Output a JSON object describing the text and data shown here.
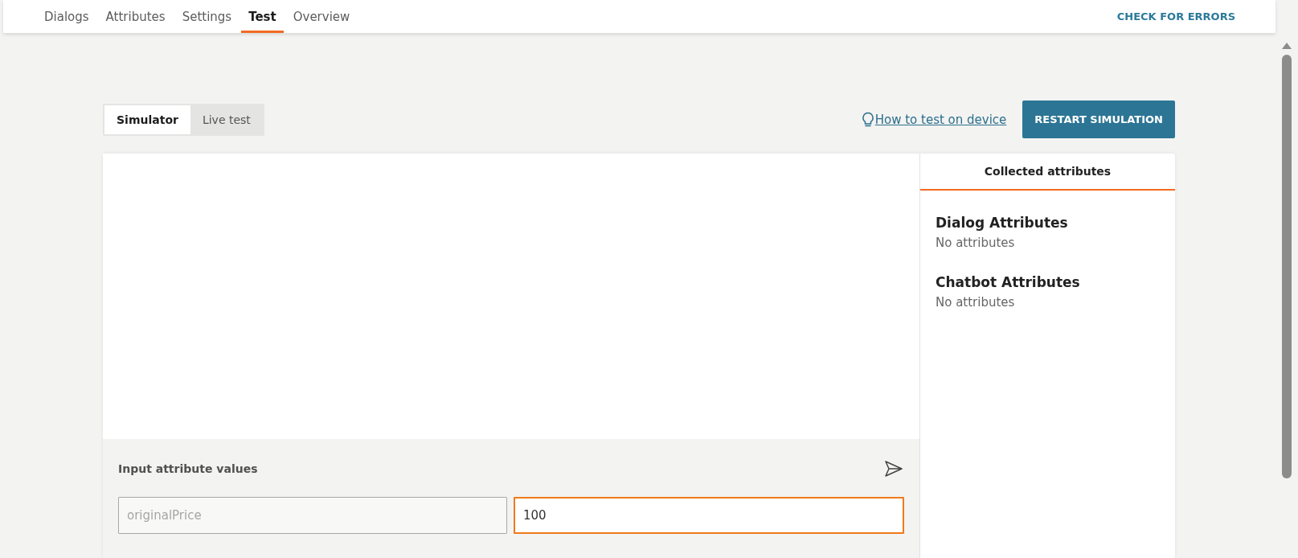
{
  "nav": {
    "tabs": [
      {
        "label": "Dialogs",
        "selected": false
      },
      {
        "label": "Attributes",
        "selected": false
      },
      {
        "label": "Settings",
        "selected": false
      },
      {
        "label": "Test",
        "selected": true
      },
      {
        "label": "Overview",
        "selected": false
      }
    ],
    "action": "CHECK FOR ERRORS"
  },
  "mode_toggle": [
    {
      "label": "Simulator",
      "selected": true
    },
    {
      "label": "Live test",
      "selected": false
    }
  ],
  "help_link": "How to test on device",
  "restart_button": "RESTART SIMULATION",
  "input_panel": {
    "title": "Input attribute values",
    "fields": [
      {
        "placeholder": "originalPrice",
        "focused": false
      },
      {
        "value": "100",
        "focused": true
      }
    ]
  },
  "side_panel": {
    "tab": "Collected attributes",
    "sections": [
      {
        "title": "Dialog Attributes",
        "text": "No attributes"
      },
      {
        "title": "Chatbot Attributes",
        "text": "No attributes"
      }
    ]
  }
}
